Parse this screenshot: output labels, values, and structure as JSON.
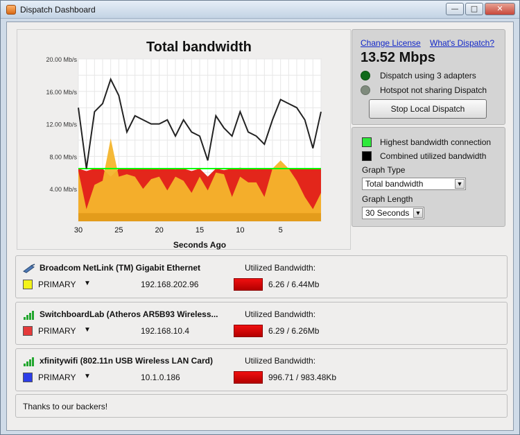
{
  "window": {
    "title": "Dispatch Dashboard"
  },
  "chart": {
    "title": "Total bandwidth",
    "xlabel": "Seconds Ago"
  },
  "chart_data": {
    "type": "area",
    "title": "Total bandwidth",
    "xlabel": "Seconds Ago",
    "ylabel": "",
    "xlim": [
      30,
      0
    ],
    "ylim": [
      0,
      20
    ],
    "x_ticks": [
      "30",
      "25",
      "20",
      "15",
      "10",
      "5"
    ],
    "y_ticks": [
      "20.00 Mb/s",
      "16.00 Mb/s",
      "12.00 Mb/s",
      "8.00 Mb/s",
      "4.00 Mb/s"
    ],
    "x": [
      30,
      29,
      28,
      27,
      26,
      25,
      24,
      23,
      22,
      21,
      20,
      19,
      18,
      17,
      16,
      15,
      14,
      13,
      12,
      11,
      10,
      9,
      8,
      7,
      6,
      5,
      4,
      3,
      2,
      1,
      0
    ],
    "series": [
      {
        "name": "Combined utilized bandwidth",
        "color": "#000000",
        "values": [
          14,
          6.5,
          13.5,
          14.5,
          17.5,
          15.5,
          11,
          13,
          12.5,
          12,
          12,
          12.5,
          10.5,
          12.5,
          11,
          10.5,
          7.5,
          13,
          11.5,
          10.5,
          13.5,
          11,
          10.5,
          9.5,
          12.5,
          15,
          14.5,
          14,
          12.5,
          9,
          13.5
        ]
      },
      {
        "name": "Highest bandwidth connection",
        "color": "#00ff00",
        "values": [
          6.5,
          6.5,
          6.5,
          6.5,
          6.5,
          6.5,
          6.5,
          6.5,
          6.5,
          6.5,
          6.5,
          6.5,
          6.5,
          6.5,
          6.5,
          6.5,
          6.5,
          6.5,
          6.5,
          6.5,
          6.5,
          6.5,
          6.5,
          6.5,
          6.5,
          6.5,
          6.5,
          6.5,
          6.5,
          6.5,
          6.5
        ]
      },
      {
        "name": "",
        "color": "#e3261b",
        "values": [
          6.5,
          6.2,
          6.5,
          6.5,
          5.5,
          6.5,
          6.5,
          6.5,
          6.5,
          6.5,
          6.4,
          6.5,
          6.4,
          6.5,
          6.2,
          6.5,
          5.5,
          6.5,
          6.3,
          6.5,
          6.6,
          6.5,
          6.4,
          6.5,
          6.4,
          6.5,
          6.5,
          6.5,
          6.5,
          6.5,
          6.5
        ]
      },
      {
        "name": "",
        "color": "#f4b52c",
        "values": [
          6.2,
          1.5,
          4.5,
          5,
          10.2,
          5.5,
          5.8,
          5.5,
          4,
          5.2,
          5.5,
          3.8,
          5.5,
          5,
          3.5,
          5.5,
          3.8,
          6,
          5.8,
          3,
          5.5,
          4.8,
          4.8,
          3,
          6.5,
          7.5,
          6.5,
          5,
          3,
          1.5,
          3.5
        ]
      }
    ]
  },
  "license": {
    "change_license": "Change License",
    "whats_dispatch": "What's Dispatch?",
    "speed": "13.52 Mbps",
    "status1": "Dispatch using 3 adapters",
    "status2": "Hotspot not sharing Dispatch",
    "stop_button": "Stop Local Dispatch"
  },
  "legend": {
    "highest": "Highest bandwidth connection",
    "combined": "Combined utilized bandwidth",
    "graph_type_label": "Graph Type",
    "graph_type_value": "Total bandwidth",
    "graph_length_label": "Graph Length",
    "graph_length_value": "30 Seconds"
  },
  "adapters": [
    {
      "name": "Broadcom NetLink (TM) Gigabit Ethernet",
      "role": "PRIMARY",
      "ip": "192.168.202.96",
      "util_label": "Utilized Bandwidth:",
      "util_value": "6.26 / 6.44Mb",
      "color": "#f3f31a"
    },
    {
      "name": "SwitchboardLab (Atheros AR5B93 Wireless...",
      "role": "PRIMARY",
      "ip": "192.168.10.4",
      "util_label": "Utilized Bandwidth:",
      "util_value": "6.29 / 6.26Mb",
      "color": "#e53a3a"
    },
    {
      "name": "xfinitywifi (802.11n USB Wireless LAN Card)",
      "role": "PRIMARY",
      "ip": "10.1.0.186",
      "util_label": "Utilized Bandwidth:",
      "util_value": "996.71 / 983.48Kb",
      "color": "#2d3ee8"
    }
  ],
  "footer": {
    "backers": "Thanks to our backers!"
  }
}
